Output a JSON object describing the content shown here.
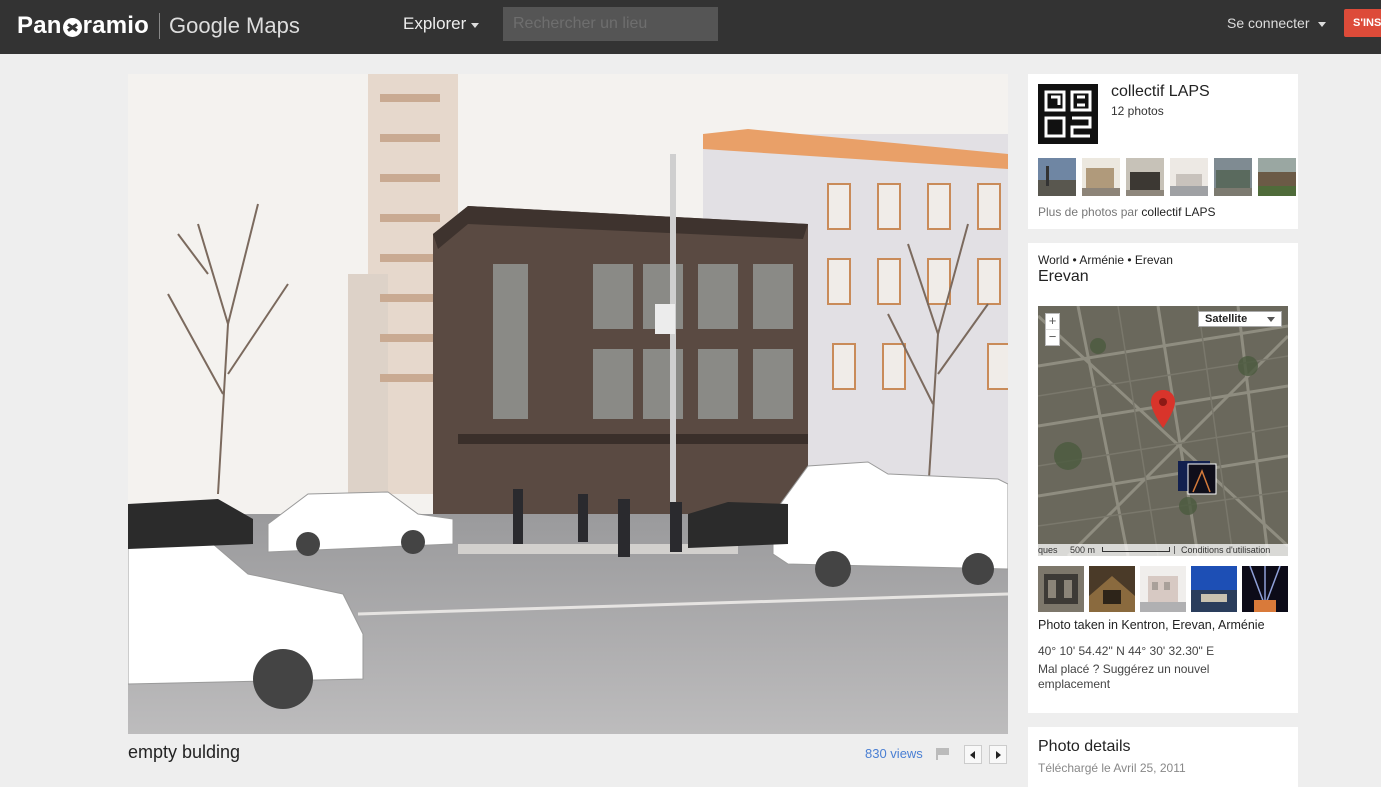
{
  "header": {
    "brand": "Pan",
    "brand_rest": "ramio",
    "product": "Google Maps",
    "explore_label": "Explorer",
    "search_placeholder": "Rechercher un lieu",
    "signin_label": "Se connecter",
    "signup_label": "S'INS"
  },
  "photo": {
    "title": "empty bulding",
    "views": "830 views"
  },
  "author": {
    "name": "collectif LAPS",
    "photo_count": "12 photos",
    "more_prefix": "Plus de photos par",
    "more_link": "collectif LAPS"
  },
  "location": {
    "breadcrumb": "World • Arménie • Erevan",
    "place": "Erevan",
    "map": {
      "type_label": "Satellite",
      "zoom_in": "+",
      "zoom_out": "−",
      "footer_left": "ques",
      "scale": "500 m",
      "terms": "Conditions d'utilisation"
    },
    "taken_in": "Photo taken in Kentron, Erevan, Arménie",
    "coordinates": "40° 10' 54.42\" N  44° 30' 32.30\" E",
    "misplaced": "Mal placé ? Suggérez un nouvel emplacement"
  },
  "details": {
    "title": "Photo details",
    "uploaded": "Téléchargé le Avril 25, 2011"
  },
  "colors": {
    "topbar": "#333333",
    "signup": "#dd4b39",
    "link": "#4a7fd3",
    "map_pin": "#d9342b"
  },
  "icons": [
    "panoramio-logo-icon",
    "caret-down-icon",
    "flag-icon",
    "prev-arrow-icon",
    "next-arrow-icon",
    "map-pin-icon"
  ]
}
